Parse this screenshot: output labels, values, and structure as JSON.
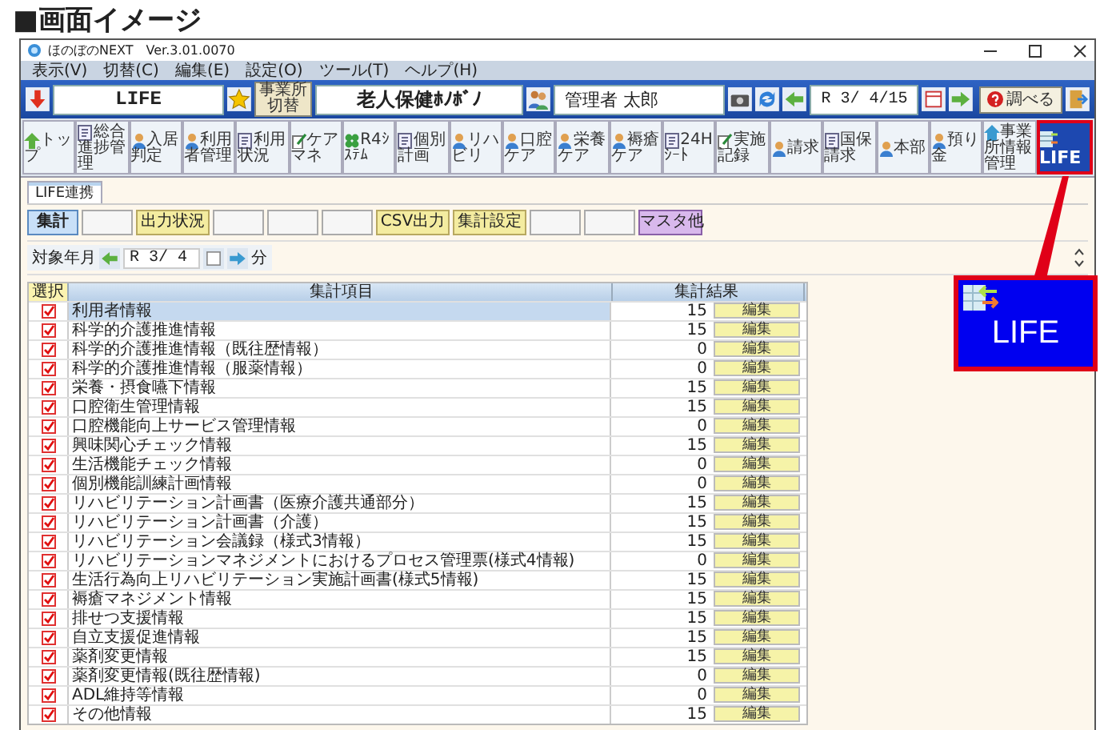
{
  "heading": "■画面イメージ",
  "window": {
    "title": "ほのぼのNEXT",
    "version": "Ver.3.01.0070"
  },
  "menu": [
    "表示(V)",
    "切替(C)",
    "編集(E)",
    "設定(O)",
    "ツール(T)",
    "ヘルプ(H)"
  ],
  "header": {
    "system": "LIFE",
    "office_button": "事業所切替",
    "office": "老人保健ﾎﾉﾎﾞﾉ",
    "user": "管理者 太郎",
    "date": "R 3/ 4/15",
    "search_button": "調べる"
  },
  "toolbar": [
    {
      "label": "トップ",
      "selected": false
    },
    {
      "label": "総合進捗管理",
      "selected": false
    },
    {
      "label": "入居判定",
      "selected": false
    },
    {
      "label": "利用者管理",
      "selected": false
    },
    {
      "label": "利用状況",
      "selected": false
    },
    {
      "label": "ケアマネ",
      "selected": false
    },
    {
      "label": "R4ｼｽﾃﾑ",
      "selected": false
    },
    {
      "label": "個別計画",
      "selected": false
    },
    {
      "label": "リハビリ",
      "selected": false
    },
    {
      "label": "口腔ケア",
      "selected": false
    },
    {
      "label": "栄養ケア",
      "selected": false
    },
    {
      "label": "褥瘡ケア",
      "selected": false
    },
    {
      "label": "24Hｼｰﾄ",
      "selected": false
    },
    {
      "label": "実施記録",
      "selected": false
    },
    {
      "label": "請求",
      "selected": false
    },
    {
      "label": "国保請求",
      "selected": false
    },
    {
      "label": "本部",
      "selected": false
    },
    {
      "label": "預り金",
      "selected": false
    },
    {
      "label": "事業所情報管理",
      "selected": false
    },
    {
      "label": "LIFE",
      "selected": true
    }
  ],
  "tabs": [
    {
      "label": "LIFE連携",
      "selected": true
    }
  ],
  "actions": [
    {
      "kind": "primary",
      "label": "集計"
    },
    {
      "kind": "blank"
    },
    {
      "kind": "function",
      "label": "出力状況"
    },
    {
      "kind": "blank"
    },
    {
      "kind": "blank"
    },
    {
      "kind": "blank"
    },
    {
      "kind": "function",
      "label": "CSV出力"
    },
    {
      "kind": "function",
      "label": "集計設定"
    },
    {
      "kind": "blank"
    },
    {
      "kind": "blank"
    },
    {
      "kind": "master",
      "label": "マスタ他"
    }
  ],
  "period": {
    "label": "対象年月",
    "value": "R 3/ 4",
    "unit": "分"
  },
  "table": {
    "columns": [
      "選択",
      "集計項目",
      "集計結果"
    ],
    "rows": [
      {
        "item": "利用者情報",
        "count": "15",
        "checked": true,
        "selected": true,
        "action": "編集"
      },
      {
        "item": "科学的介護推進情報",
        "count": "15",
        "checked": true,
        "selected": false,
        "action": "編集"
      },
      {
        "item": "科学的介護推進情報（既往歴情報）",
        "count": "0",
        "checked": true,
        "selected": false,
        "action": "編集"
      },
      {
        "item": "科学的介護推進情報（服薬情報）",
        "count": "0",
        "checked": true,
        "selected": false,
        "action": "編集"
      },
      {
        "item": "栄養・摂食嚥下情報",
        "count": "15",
        "checked": true,
        "selected": false,
        "action": "編集"
      },
      {
        "item": "口腔衛生管理情報",
        "count": "15",
        "checked": true,
        "selected": false,
        "action": "編集"
      },
      {
        "item": "口腔機能向上サービス管理情報",
        "count": "0",
        "checked": true,
        "selected": false,
        "action": "編集"
      },
      {
        "item": "興味関心チェック情報",
        "count": "15",
        "checked": true,
        "selected": false,
        "action": "編集"
      },
      {
        "item": "生活機能チェック情報",
        "count": "0",
        "checked": true,
        "selected": false,
        "action": "編集"
      },
      {
        "item": "個別機能訓練計画情報",
        "count": "0",
        "checked": true,
        "selected": false,
        "action": "編集"
      },
      {
        "item": "リハビリテーション計画書（医療介護共通部分）",
        "count": "15",
        "checked": true,
        "selected": false,
        "action": "編集"
      },
      {
        "item": "リハビリテーション計画書（介護）",
        "count": "15",
        "checked": true,
        "selected": false,
        "action": "編集"
      },
      {
        "item": "リハビリテーション会議録（様式3情報）",
        "count": "15",
        "checked": true,
        "selected": false,
        "action": "編集"
      },
      {
        "item": "リハビリテーションマネジメントにおけるプロセス管理票(様式4情報)",
        "count": "0",
        "checked": true,
        "selected": false,
        "action": "編集"
      },
      {
        "item": "生活行為向上リハビリテーション実施計画書(様式5情報)",
        "count": "15",
        "checked": true,
        "selected": false,
        "action": "編集"
      },
      {
        "item": "褥瘡マネジメント情報",
        "count": "15",
        "checked": true,
        "selected": false,
        "action": "編集"
      },
      {
        "item": "排せつ支援情報",
        "count": "15",
        "checked": true,
        "selected": false,
        "action": "編集"
      },
      {
        "item": "自立支援促進情報",
        "count": "15",
        "checked": true,
        "selected": false,
        "action": "編集"
      },
      {
        "item": "薬剤変更情報",
        "count": "15",
        "checked": true,
        "selected": false,
        "action": "編集"
      },
      {
        "item": "薬剤変更情報(既往歴情報)",
        "count": "0",
        "checked": true,
        "selected": false,
        "action": "編集"
      },
      {
        "item": "ADL維持等情報",
        "count": "0",
        "checked": true,
        "selected": false,
        "action": "編集"
      },
      {
        "item": "その他情報",
        "count": "15",
        "checked": true,
        "selected": false,
        "action": "編集"
      }
    ]
  },
  "callout": {
    "label": "LIFE"
  }
}
